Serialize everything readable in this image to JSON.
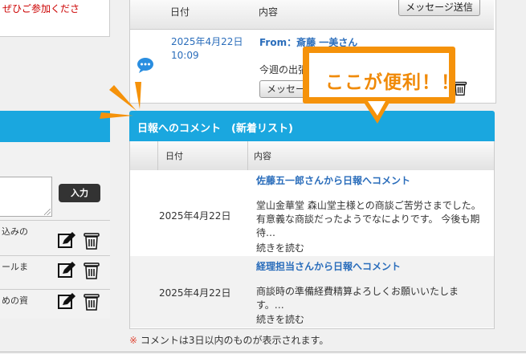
{
  "left": {
    "top_text_line1": "ぜひご参加くださ",
    "input_button": "入力",
    "rows": [
      {
        "text": "込みの"
      },
      {
        "text": "ールま"
      },
      {
        "text": "めの資"
      }
    ]
  },
  "messages": {
    "col_date": "日付",
    "col_content": "内容",
    "send_button": "メッセージ送信",
    "item": {
      "date": "2025年4月22日",
      "time": "10:09",
      "from": "From：斎藤 一美さん",
      "body": "今週の出張",
      "button": "メッセー"
    }
  },
  "callout": {
    "text": "ここが便利！！"
  },
  "comments": {
    "title": "日報へのコメント　(新着リスト)",
    "col_date": "日付",
    "col_content": "内容",
    "rows": [
      {
        "date": "2025年4月22日",
        "title": "佐藤五一郎さんから日報へコメント",
        "body": "堂山金華堂 森山堂主様との商談ご苦労さまでした。 有意義な商談だったようでなによりです。 今後も期待…",
        "more": "続きを読む"
      },
      {
        "date": "2025年4月22日",
        "title": "経理担当さんから日報へコメント",
        "body": "商談時の準備経費精算よろしくお願いいたします。…",
        "more": "続きを読む"
      }
    ],
    "note_mark": "※",
    "note": "コメントは3日以内のものが表示されます。"
  },
  "colors": {
    "accent": "#1aa7df",
    "link": "#2a6dbb",
    "callout": "#f5920a"
  }
}
